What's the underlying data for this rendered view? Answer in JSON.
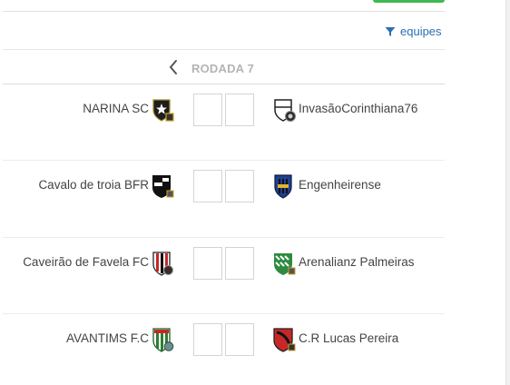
{
  "filter": {
    "label": "equipes",
    "icon": "filter-icon",
    "color": "#2a6fb3"
  },
  "round": {
    "label": "RODADA 7",
    "prev_icon": "chevron-left-icon"
  },
  "matches": [
    {
      "home": "NARINA SC",
      "away": "InvasãoCorinthiana76",
      "home_score": "",
      "away_score": ""
    },
    {
      "home": "Cavalo de troia BFR",
      "away": "Engenheirense",
      "home_score": "",
      "away_score": ""
    },
    {
      "home": "Caveirão de Favela FC",
      "away": "Arenalianz Palmeiras",
      "home_score": "",
      "away_score": ""
    },
    {
      "home": "AVANTIMS F.C",
      "away": "C.R Lucas Pereira",
      "home_score": "",
      "away_score": ""
    }
  ]
}
